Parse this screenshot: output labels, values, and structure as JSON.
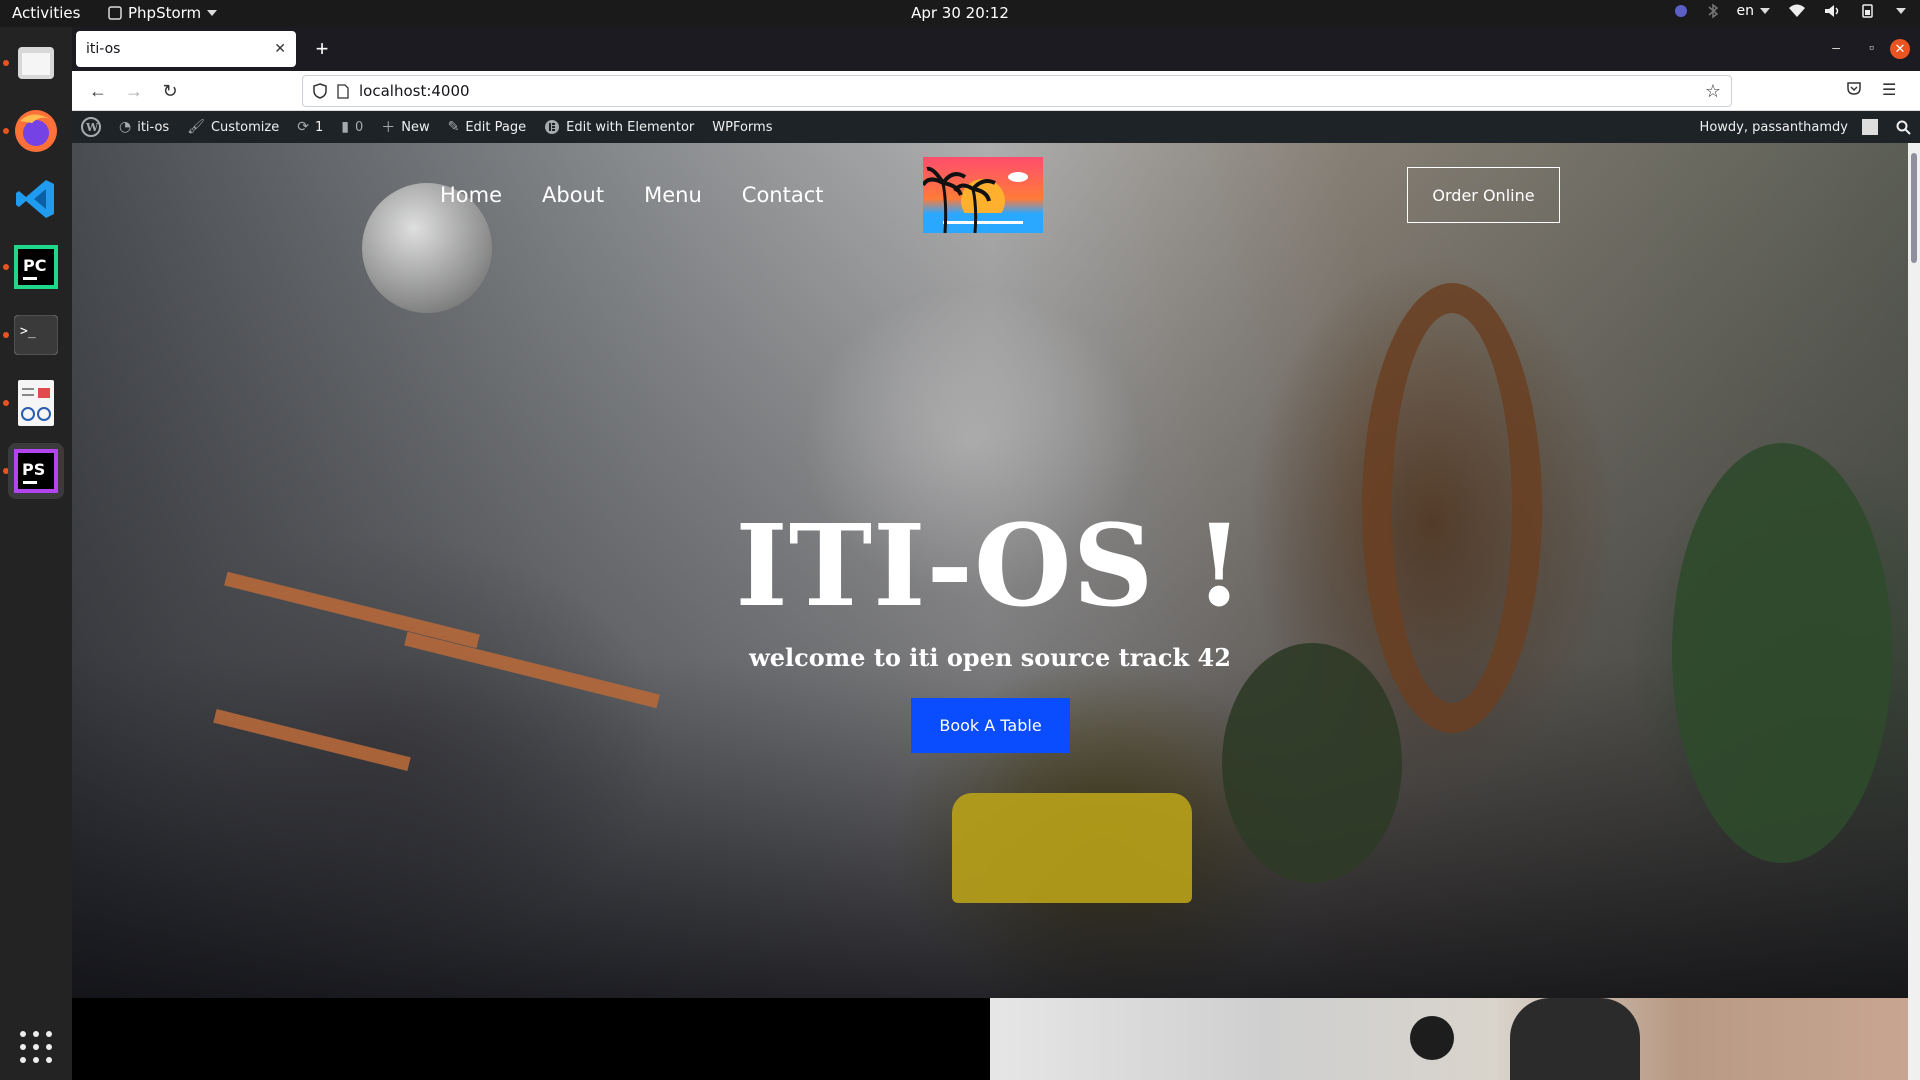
{
  "topbar": {
    "activities": "Activities",
    "app_name": "PhpStorm",
    "clock": "Apr 30  20:12",
    "language": "en"
  },
  "dock": {
    "items": [
      {
        "icon": "files-icon"
      },
      {
        "icon": "firefox-icon"
      },
      {
        "icon": "vscode-icon"
      },
      {
        "icon": "pycharm-icon",
        "label": "PC"
      },
      {
        "icon": "terminal-icon",
        "label": ">_"
      },
      {
        "icon": "document-viewer-icon"
      },
      {
        "icon": "phpstorm-icon",
        "label": "PS"
      }
    ]
  },
  "browser": {
    "tab_title": "iti-os",
    "url": "localhost:4000"
  },
  "wp_admin_bar": {
    "site_name": "iti-os",
    "customize": "Customize",
    "updates_count": "1",
    "comments_count": "0",
    "new": "New",
    "edit_page": "Edit Page",
    "edit_elementor": "Edit with Elementor",
    "wpforms": "WPForms",
    "howdy": "Howdy, passanthamdy"
  },
  "site": {
    "nav": [
      "Home",
      "About",
      "Menu",
      "Contact"
    ],
    "order_button": "Order Online",
    "hero_title": "ITI-OS !",
    "hero_subtitle": "welcome to iti open source track 42",
    "book_button": "Book A Table"
  },
  "colors": {
    "accent_orange": "#e95420",
    "book_button": "#0a4cff",
    "wp_bar": "#1d2327"
  }
}
